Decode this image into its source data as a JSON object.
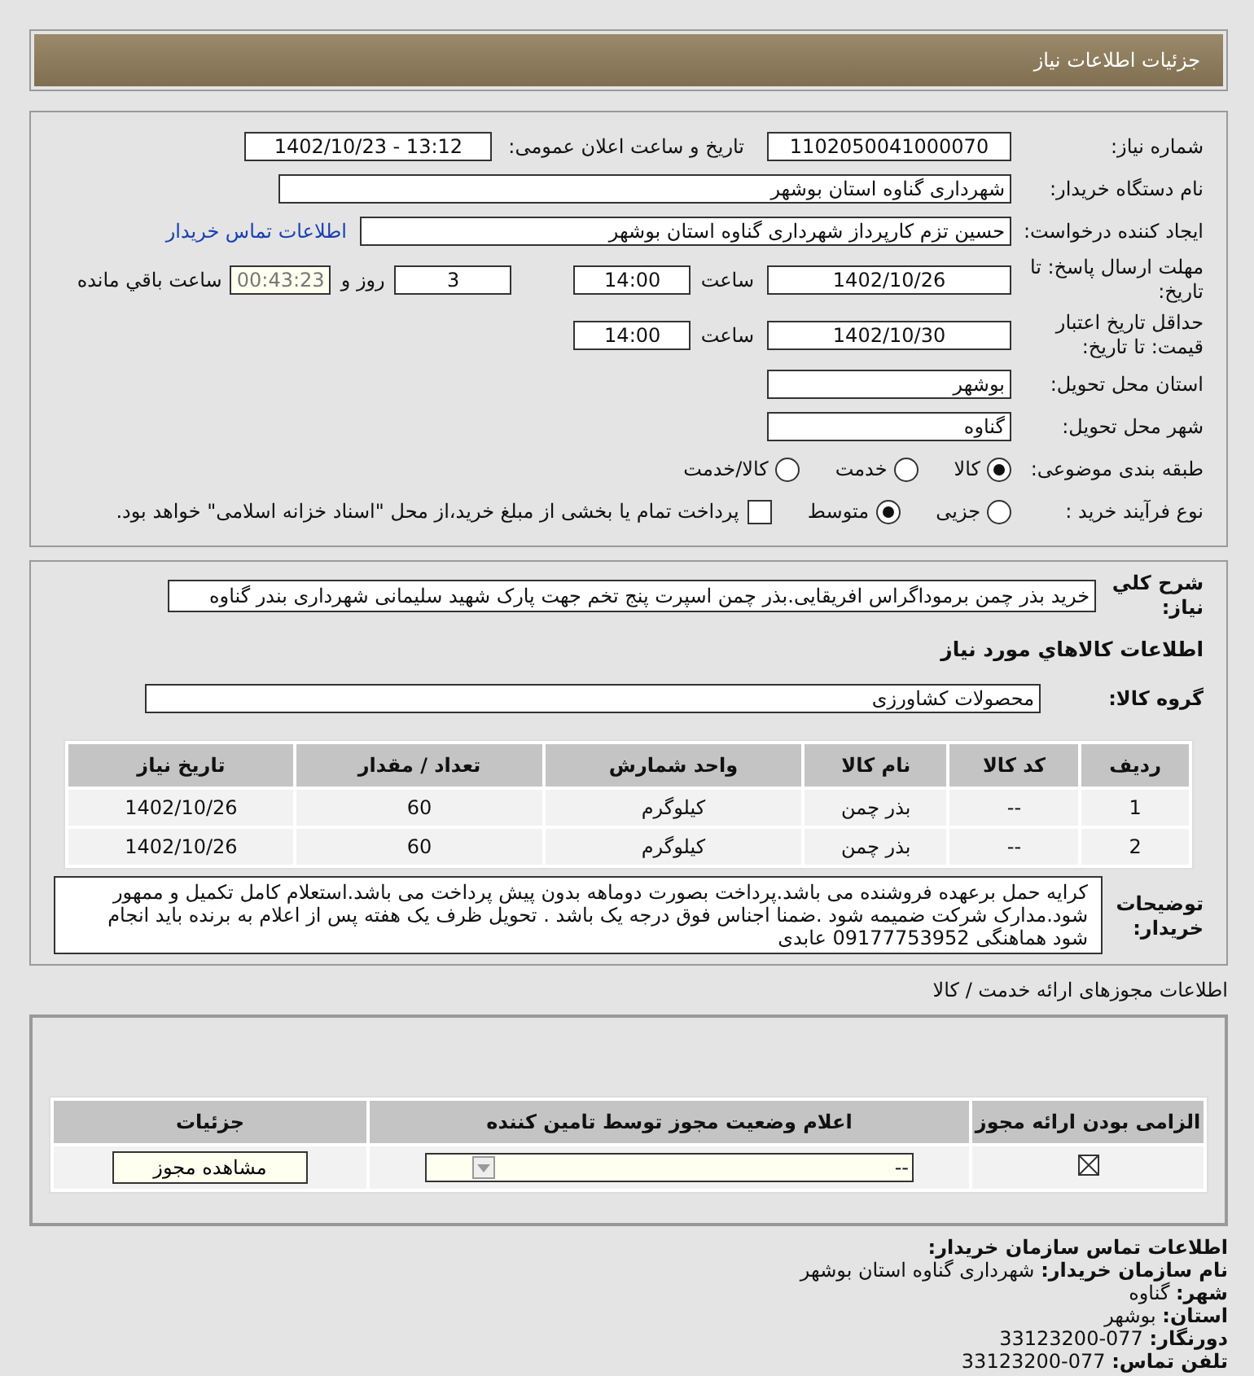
{
  "header": {
    "title": "جزئیات اطلاعات نیاز"
  },
  "need": {
    "number": {
      "label": "شماره نیاز:",
      "value": "1102050041000070"
    },
    "announce": {
      "label": "تاریخ و ساعت اعلان عمومی:",
      "value": "1402/10/23 - 13:12"
    },
    "buyer": {
      "label": "نام دستگاه خریدار:",
      "value": "شهرداری گناوه استان بوشهر"
    },
    "requester": {
      "label": "ایجاد کننده درخواست:",
      "value": "حسین تزم کارپرداز شهرداری گناوه استان بوشهر",
      "link": "اطلاعات تماس خریدار"
    },
    "deadline": {
      "label": "مهلت ارسال پاسخ: تا تاریخ:",
      "date": "1402/10/26",
      "time_label": "ساعت",
      "time": "14:00",
      "days": "3",
      "days_label": "روز و",
      "remaining": "00:43:23",
      "remaining_label": "ساعت باقي مانده"
    },
    "validity": {
      "label": "حداقل تاریخ اعتبار قیمت: تا تاریخ:",
      "date": "1402/10/30",
      "time_label": "ساعت",
      "time": "14:00"
    },
    "province": {
      "label": "استان محل تحویل:",
      "value": "بوشهر"
    },
    "city": {
      "label": "شهر محل تحویل:",
      "value": "گناوه"
    },
    "category": {
      "label": "طبقه بندی موضوعی:",
      "options": [
        {
          "label": "کالا",
          "selected": true
        },
        {
          "label": "خدمت",
          "selected": false
        },
        {
          "label": "کالا/خدمت",
          "selected": false
        }
      ]
    },
    "process": {
      "label": "نوع فرآیند خرید :",
      "options": [
        {
          "label": "جزیی",
          "selected": false
        },
        {
          "label": "متوسط",
          "selected": true
        }
      ],
      "payment": {
        "checked": false,
        "text": "پرداخت تمام یا بخشی از مبلغ خرید،از محل \"اسناد خزانه اسلامی\" خواهد بود."
      }
    }
  },
  "goods": {
    "summary": {
      "label": "شرح كلي نياز:",
      "value": "خرید بذر چمن برموداگراس افریقایی.بذر چمن اسپرت پنج تخم جهت پارک شهید سلیمانی شهرداری بندر گناوه"
    },
    "title": "اطلاعات كالاهاي مورد نياز",
    "group": {
      "label": "گروه کالا:",
      "value": "محصولات کشاورزی"
    },
    "table": {
      "columns": [
        "ردیف",
        "کد کالا",
        "نام کالا",
        "واحد شمارش",
        "تعداد / مقدار",
        "تاریخ نیاز"
      ],
      "rows": [
        [
          "1",
          "--",
          "بذر چمن",
          "کیلوگرم",
          "60",
          "1402/10/26"
        ],
        [
          "2",
          "--",
          "بذر چمن",
          "کیلوگرم",
          "60",
          "1402/10/26"
        ]
      ]
    },
    "notes": {
      "label": "توضیحات خریدار:",
      "value": "کرایه حمل برعهده فروشنده می باشد.پرداخت بصورت دوماهه بدون پیش پرداخت می باشد.استعلام کامل تکمیل و ممهور شود.مدارک شرکت ضمیمه شود .ضمنا اجناس فوق درجه یک باشد . تحویل ظرف یک هفته پس از اعلام به برنده باید انجام شود هماهنگی 09177753952 عابدی"
    }
  },
  "licenses": {
    "title": "اطلاعات مجوزهای ارائه خدمت / کالا",
    "columns": [
      "الزامی بودن ارائه مجوز",
      "اعلام وضعیت مجوز توسط تامین کننده",
      "جزئیات"
    ],
    "rows": [
      {
        "required": true,
        "status": "--",
        "button": "مشاهده مجوز"
      }
    ]
  },
  "contact": {
    "title": "اطلاعات تماس سازمان خریدار:",
    "items": [
      {
        "label": "نام سازمان خریدار:",
        "value": "شهرداری گناوه استان بوشهر"
      },
      {
        "label": "شهر:",
        "value": "گناوه"
      },
      {
        "label": "استان:",
        "value": "بوشهر"
      },
      {
        "label": "دورنگار:",
        "value": "33123200-077"
      },
      {
        "label": "تلفن تماس:",
        "value": "33123200-077"
      }
    ]
  }
}
